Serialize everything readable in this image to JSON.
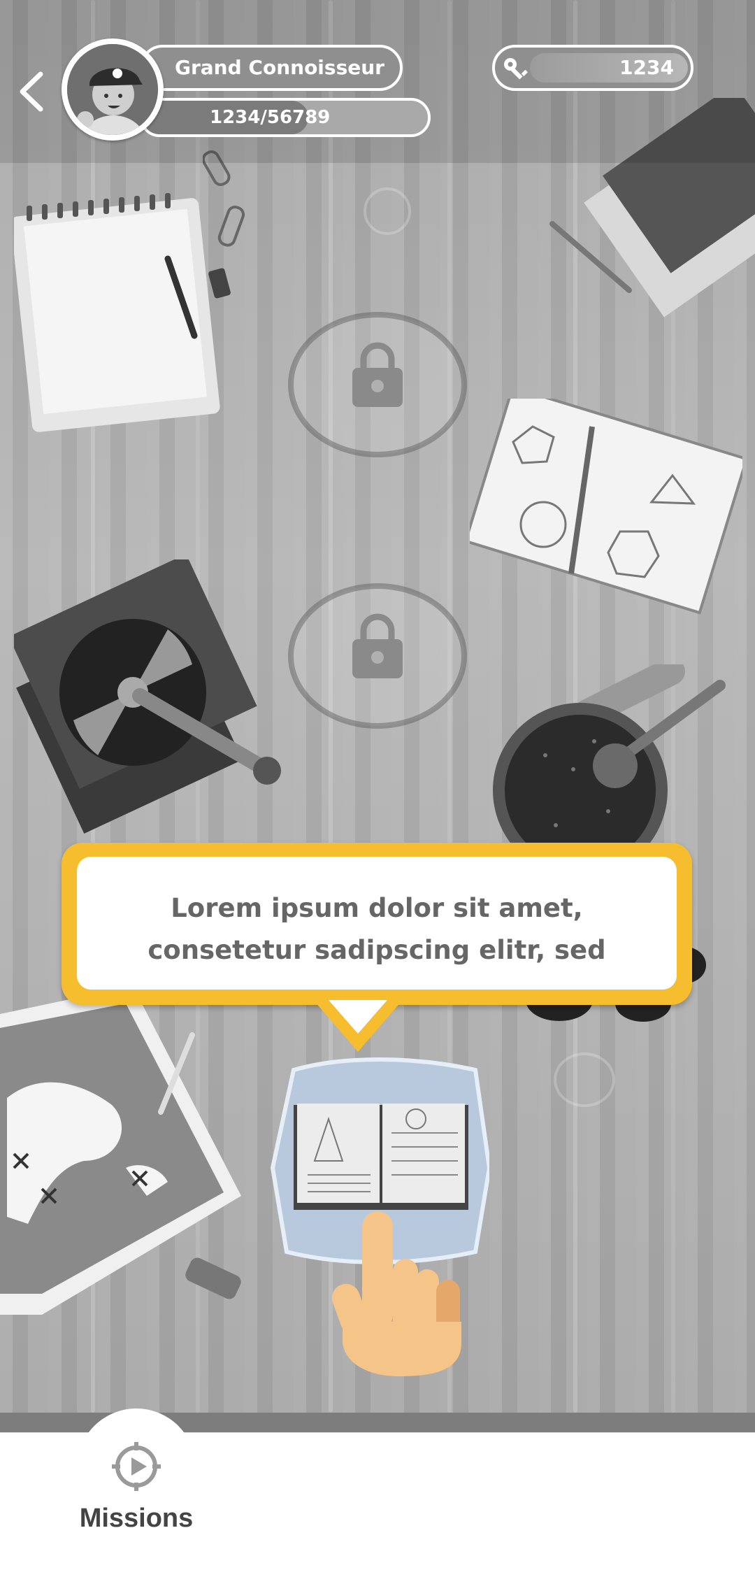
{
  "header": {
    "rank_title": "Grand Connoisseur",
    "xp_text": "1234/56789",
    "xp_progress": 0.58,
    "keys_count": "1234",
    "icons": [
      "back-arrow-icon",
      "avatar-icon",
      "key-icon"
    ]
  },
  "tooltip": {
    "line1": "Lorem ipsum dolor sit amet,",
    "line2": "consetetur sadipscing elitr, sed"
  },
  "board": {
    "locked_items": [
      "lock-icon",
      "lock-icon"
    ],
    "props": [
      "notepad",
      "paperclips",
      "binder-clip",
      "books",
      "pencil",
      "spiral-notebook",
      "record-player",
      "pot",
      "map",
      "eraser",
      "open-book",
      "pointing-hand"
    ]
  },
  "bottom_nav": {
    "missions_label": "Missions",
    "icons": [
      "missions-compass-icon"
    ]
  },
  "colors": {
    "accent": "#f6bd2e",
    "book_highlight": "#b9c9dd",
    "hand": "#f5c489"
  }
}
